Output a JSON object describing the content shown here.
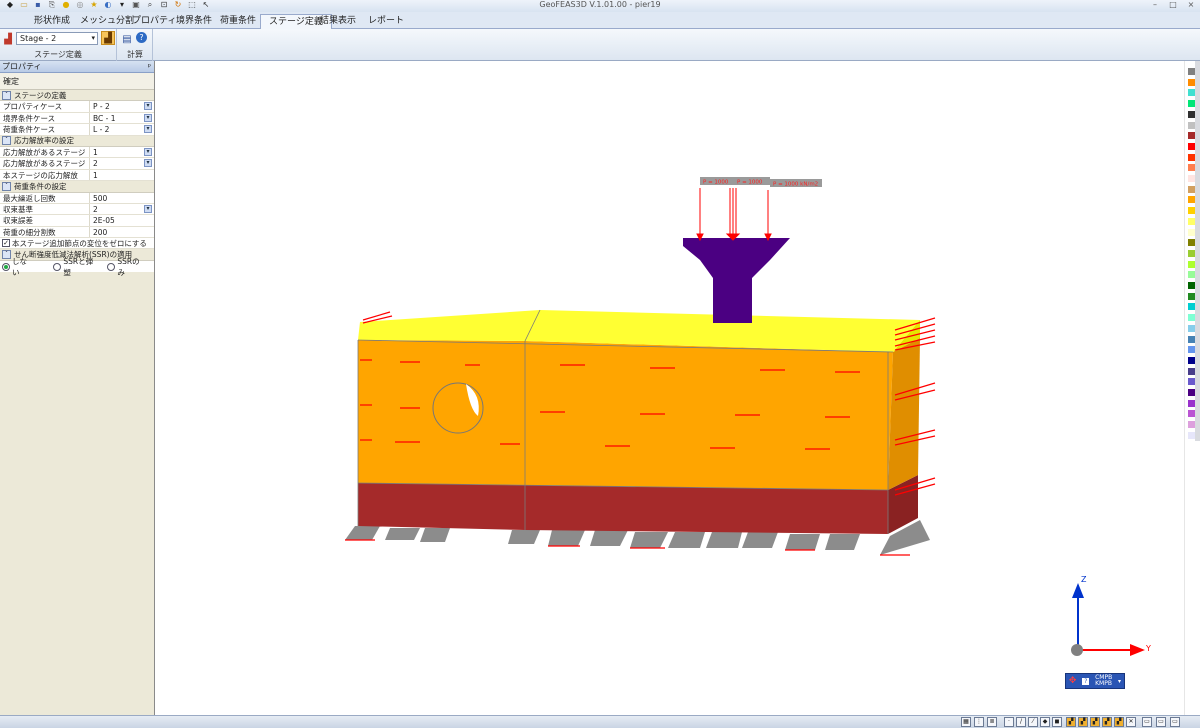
{
  "window": {
    "title": "GeoFEAS3D  V.1.01.00 - pier19",
    "minimize": "–",
    "maximize": "□",
    "close": "×"
  },
  "tabs": [
    {
      "label": "形状作成",
      "active": false
    },
    {
      "label": "メッシュ分割",
      "active": false
    },
    {
      "label": "プロパティ",
      "active": false
    },
    {
      "label": "境界条件",
      "active": false
    },
    {
      "label": "荷重条件",
      "active": false
    },
    {
      "label": "ステージ定義",
      "active": true
    },
    {
      "label": "結果表示",
      "active": false
    },
    {
      "label": "レポート",
      "active": false
    }
  ],
  "ribbon": {
    "stage_value": "Stage - 2",
    "group_stage": "ステージ定義",
    "group_calc": "計算"
  },
  "panel": {
    "title": "プロパティ",
    "pin": "ᵖ",
    "confirm": "確定",
    "sections": {
      "stage_def": "ステージの定義",
      "stress_release": "応力解放率の設定",
      "load_cond": "荷重条件の設定",
      "ssr": "せん断強度低減法解析(SSR)の適用"
    },
    "rows": {
      "property_case": {
        "label": "プロパティケース",
        "value": "P - 2"
      },
      "boundary_case": {
        "label": "境界条件ケース",
        "value": "BC - 1"
      },
      "load_case": {
        "label": "荷重条件ケース",
        "value": "L - 2"
      },
      "release_stage_1": {
        "label": "応力解放があるステージ",
        "value": "1"
      },
      "release_stage_2": {
        "label": "応力解放があるステージ",
        "value": "2"
      },
      "this_stage_release": {
        "label": "本ステージの応力解放",
        "value": "1"
      },
      "max_iter": {
        "label": "最大繰返し回数",
        "value": "500"
      },
      "conv_criterion": {
        "label": "収束基準",
        "value": "2"
      },
      "conv_error": {
        "label": "収束誤差",
        "value": "2E-05"
      },
      "load_steps": {
        "label": "荷重の細分割数",
        "value": "200"
      }
    },
    "zero_disp_checkbox": "本ステージ追加節点の変位をゼロにする",
    "ssr_options": [
      "しない",
      "SSRと弾塑",
      "SSRのみ"
    ],
    "ssr_selected": 0
  },
  "loads": {
    "label_1": "P = 1000",
    "label_2": "P = 1000",
    "label_3": "P = 1000 kN/m2"
  },
  "axes": {
    "z": "Z",
    "y": "Y"
  },
  "navbox": {
    "line1": "CMPB",
    "line2": "KMPB"
  },
  "colors": {
    "yellow_layer": "#ffff33",
    "orange_layer": "#ffa500",
    "brown_layer": "#a52a2a",
    "pier": "#4b0082",
    "footing": "#8c8c8c",
    "load": "#ff0000",
    "axis": "#0033cc"
  },
  "palette": [
    "#808080",
    "#ff8c00",
    "#40e0d0",
    "#00e676",
    "#303030",
    "#c0c0c0",
    "#a52a2a",
    "#ff0000",
    "#ff3300",
    "#ff7f50",
    "#ffe4e1",
    "#d2a060",
    "#ffa500",
    "#ffd000",
    "#ffff66",
    "#ffffcc",
    "#808000",
    "#9acd32",
    "#adff2f",
    "#98fb98",
    "#006400",
    "#228b22",
    "#00ced1",
    "#7fffd4",
    "#87ceeb",
    "#4682b4",
    "#6495ed",
    "#00008b",
    "#483d8b",
    "#6a5acd",
    "#4b0082",
    "#9932cc",
    "#ba55d3",
    "#dda0dd",
    "#e6e6fa"
  ]
}
